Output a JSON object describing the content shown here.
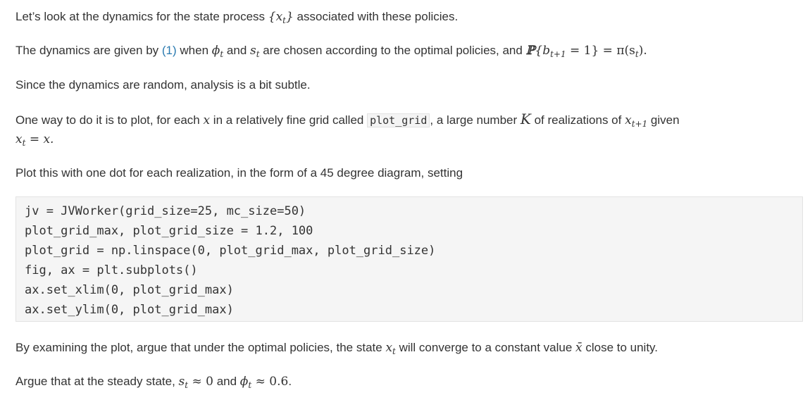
{
  "para1": {
    "before": "Let’s look at the dynamics for the state process ",
    "math": "{x",
    "math_sub": "t",
    "math_close": "}",
    "after": " associated with these policies."
  },
  "para2": {
    "t1": "The dynamics are given by ",
    "link": "(1)",
    "t2": " when ",
    "phi": "ϕ",
    "phi_sub": "t",
    "t3": " and ",
    "s": "s",
    "s_sub": "t",
    "t4": " are chosen according to the optimal policies, and ",
    "prob": "ℙ",
    "prob_open": "{b",
    "prob_sub": "t+1",
    "prob_rest": " = 1} = π(s",
    "prob_sub2": "t",
    "prob_close": ").",
    "end": ""
  },
  "para3": {
    "text": "Since the dynamics are random, analysis is a bit subtle."
  },
  "para4": {
    "t1": "One way to do it is to plot, for each ",
    "x": "x",
    "t2": " in a relatively fine grid called ",
    "code": "plot_grid",
    "t3": ", a large number ",
    "K": "K",
    "t4": " of realizations of ",
    "x2": "x",
    "x2_sub": "t+1",
    "t5": " given",
    "line2_x": "x",
    "line2_sub": "t",
    "line2_rest": " = x."
  },
  "para5": {
    "text": "Plot this with one dot for each realization, in the form of a 45 degree diagram, setting"
  },
  "code": {
    "lines": [
      "jv = JVWorker(grid_size=25, mc_size=50)",
      "plot_grid_max, plot_grid_size = 1.2, 100",
      "plot_grid = np.linspace(0, plot_grid_max, plot_grid_size)",
      "fig, ax = plt.subplots()",
      "ax.set_xlim(0, plot_grid_max)",
      "ax.set_ylim(0, plot_grid_max)"
    ]
  },
  "para6": {
    "t1": "By examining the plot, argue that under the optimal policies, the state ",
    "x": "x",
    "x_sub": "t",
    "t2": " will converge to a constant value ",
    "xbar": "x̄",
    "t3": " close to unity."
  },
  "para7": {
    "t1": "Argue that at the steady state, ",
    "s": "s",
    "s_sub": "t",
    "approx1": " ≈ 0",
    "t2": " and ",
    "phi": "ϕ",
    "phi_sub": "t",
    "approx2": " ≈ 0.6",
    "t3": "."
  }
}
